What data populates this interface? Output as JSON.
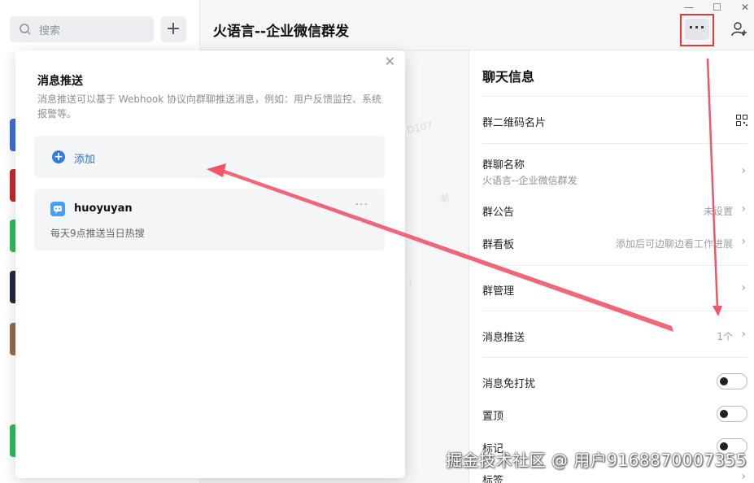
{
  "sidebar": {
    "search_placeholder": "搜索",
    "add_button": "+"
  },
  "header": {
    "title": "火语言--企业微信群发",
    "minimize": "—",
    "maximize": "☐",
    "close": "✕",
    "more": "···"
  },
  "popup": {
    "close": "✕",
    "title": "消息推送",
    "description": "消息推送可以基于 Webhook 协议向群聊推送消息，例如：用户反馈监控、系统报警等。",
    "add_label": "添加",
    "bot": {
      "name": "huoyuyan",
      "more": "···",
      "description": "每天9点推送当日热搜"
    }
  },
  "info_panel": {
    "title": "聊天信息",
    "rows": [
      {
        "label": "群二维码名片"
      },
      {
        "label": "群聊名称",
        "sub": "火语言--企业微信群发"
      },
      {
        "label": "群公告",
        "value": "未设置"
      },
      {
        "label": "群看板",
        "value": "添加后可边聊边看工作进展"
      },
      {
        "label": "群管理"
      },
      {
        "label": "消息推送",
        "value": "1个"
      },
      {
        "label": "消息免打扰"
      },
      {
        "label": "置顶"
      },
      {
        "label": "标记"
      },
      {
        "label": "标签"
      }
    ],
    "chevron": "›"
  },
  "watermark": "掘金技术社区 @ 用户9168870007355",
  "colors": {
    "accent": "#2e7be6",
    "annotation_red": "#e53935",
    "arrow_pink": "#f0566a"
  }
}
